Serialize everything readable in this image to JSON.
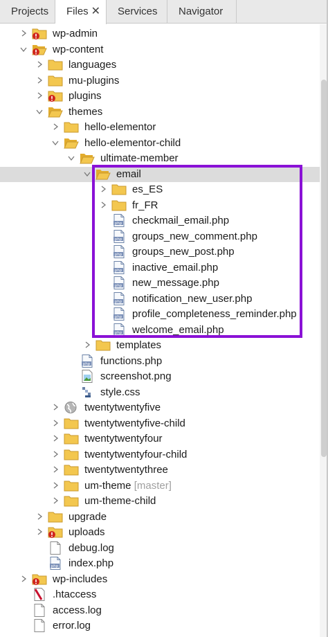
{
  "tabs": [
    {
      "label": "Projects"
    },
    {
      "label": "Files",
      "close": "✕"
    },
    {
      "label": "Services"
    },
    {
      "label": "Navigator"
    }
  ],
  "tree": [
    {
      "label": "wp-admin",
      "indent": 0,
      "chevron": "right",
      "icon": "folder-error"
    },
    {
      "label": "wp-content",
      "indent": 0,
      "chevron": "down",
      "icon": "folder-open-error"
    },
    {
      "label": "languages",
      "indent": 1,
      "chevron": "right",
      "icon": "folder"
    },
    {
      "label": "mu-plugins",
      "indent": 1,
      "chevron": "right",
      "icon": "folder"
    },
    {
      "label": "plugins",
      "indent": 1,
      "chevron": "right",
      "icon": "folder-error"
    },
    {
      "label": "themes",
      "indent": 1,
      "chevron": "down",
      "icon": "folder-open"
    },
    {
      "label": "hello-elementor",
      "indent": 2,
      "chevron": "right",
      "icon": "folder"
    },
    {
      "label": "hello-elementor-child",
      "indent": 2,
      "chevron": "down",
      "icon": "folder-open"
    },
    {
      "label": "ultimate-member",
      "indent": 3,
      "chevron": "down",
      "icon": "folder-open"
    },
    {
      "label": "email",
      "indent": 4,
      "chevron": "down",
      "icon": "folder-open",
      "selected": true
    },
    {
      "label": "es_ES",
      "indent": 5,
      "chevron": "right",
      "icon": "folder"
    },
    {
      "label": "fr_FR",
      "indent": 5,
      "chevron": "right",
      "icon": "folder"
    },
    {
      "label": "checkmail_email.php",
      "indent": 5,
      "chevron": "none",
      "icon": "php"
    },
    {
      "label": "groups_new_comment.php",
      "indent": 5,
      "chevron": "none",
      "icon": "php"
    },
    {
      "label": "groups_new_post.php",
      "indent": 5,
      "chevron": "none",
      "icon": "php"
    },
    {
      "label": "inactive_email.php",
      "indent": 5,
      "chevron": "none",
      "icon": "php"
    },
    {
      "label": "new_message.php",
      "indent": 5,
      "chevron": "none",
      "icon": "php"
    },
    {
      "label": "notification_new_user.php",
      "indent": 5,
      "chevron": "none",
      "icon": "php"
    },
    {
      "label": "profile_completeness_reminder.php",
      "indent": 5,
      "chevron": "none",
      "icon": "php"
    },
    {
      "label": "welcome_email.php",
      "indent": 5,
      "chevron": "none",
      "icon": "php"
    },
    {
      "label": "templates",
      "indent": 4,
      "chevron": "right",
      "icon": "folder"
    },
    {
      "label": "functions.php",
      "indent": 3,
      "chevron": "none",
      "icon": "php"
    },
    {
      "label": "screenshot.png",
      "indent": 3,
      "chevron": "none",
      "icon": "image"
    },
    {
      "label": "style.css",
      "indent": 3,
      "chevron": "none",
      "icon": "css"
    },
    {
      "label": "twentytwentyfive",
      "indent": 2,
      "chevron": "right",
      "icon": "globe"
    },
    {
      "label": "twentytwentyfive-child",
      "indent": 2,
      "chevron": "right",
      "icon": "folder"
    },
    {
      "label": "twentytwentyfour",
      "indent": 2,
      "chevron": "right",
      "icon": "folder"
    },
    {
      "label": "twentytwentyfour-child",
      "indent": 2,
      "chevron": "right",
      "icon": "folder"
    },
    {
      "label": "twentytwentythree",
      "indent": 2,
      "chevron": "right",
      "icon": "folder"
    },
    {
      "label": "um-theme",
      "tag": "[master]",
      "indent": 2,
      "chevron": "right",
      "icon": "folder"
    },
    {
      "label": "um-theme-child",
      "indent": 2,
      "chevron": "right",
      "icon": "folder"
    },
    {
      "label": "upgrade",
      "indent": 1,
      "chevron": "right",
      "icon": "folder"
    },
    {
      "label": "uploads",
      "indent": 1,
      "chevron": "right",
      "icon": "folder-error"
    },
    {
      "label": "debug.log",
      "indent": 1,
      "chevron": "none",
      "icon": "file"
    },
    {
      "label": "index.php",
      "indent": 1,
      "chevron": "none",
      "icon": "php"
    },
    {
      "label": "wp-includes",
      "indent": 0,
      "chevron": "right",
      "icon": "folder-error"
    },
    {
      "label": ".htaccess",
      "indent": 0,
      "chevron": "none",
      "icon": "htaccess"
    },
    {
      "label": "access.log",
      "indent": 0,
      "chevron": "none",
      "icon": "file"
    },
    {
      "label": "error.log",
      "indent": 0,
      "chevron": "none",
      "icon": "file"
    }
  ],
  "colors": {
    "highlight_box": "#8a11d6",
    "folder": "#f3c74f",
    "error_badge": "#d0261d",
    "selection": "#dcdcdc"
  }
}
